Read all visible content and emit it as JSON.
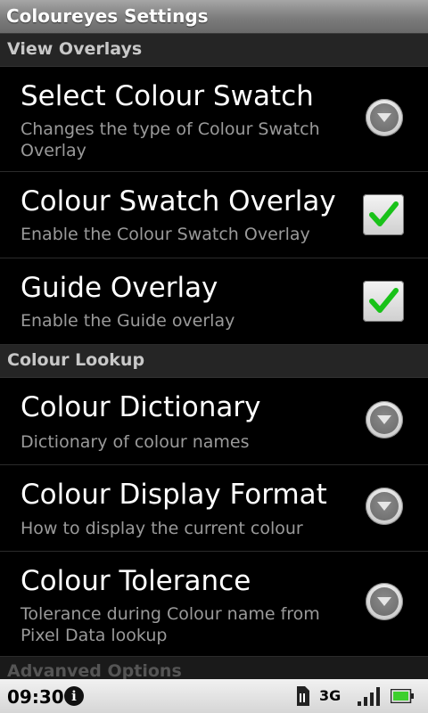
{
  "app": {
    "title": "Coloureyes Settings"
  },
  "sections": {
    "view_overlays": "View Overlays",
    "colour_lookup": "Colour Lookup",
    "advanced_options": "Advanved Options"
  },
  "items": [
    {
      "title": "Select Colour Swatch",
      "summary": "Changes the type of Colour Swatch Overlay",
      "control": "dropdown"
    },
    {
      "title": "Colour Swatch Overlay",
      "summary": "Enable the Colour Swatch Overlay",
      "control": "checkbox",
      "checked": true
    },
    {
      "title": "Guide Overlay",
      "summary": "Enable the Guide overlay",
      "control": "checkbox",
      "checked": true
    },
    {
      "title": "Colour Dictionary",
      "summary": "Dictionary of colour names",
      "control": "dropdown"
    },
    {
      "title": "Colour Display Format",
      "summary": "How to display the current colour",
      "control": "dropdown"
    },
    {
      "title": "Colour Tolerance",
      "summary": "Tolerance during Colour name from Pixel Data lookup",
      "control": "dropdown"
    }
  ],
  "status": {
    "time": "09:30",
    "network": "3G",
    "icons": [
      "info-icon",
      "sd-card-icon",
      "signal-icon",
      "battery-icon"
    ],
    "battery_color": "#3ecf2e"
  },
  "colors": {
    "check": "#19c219"
  }
}
